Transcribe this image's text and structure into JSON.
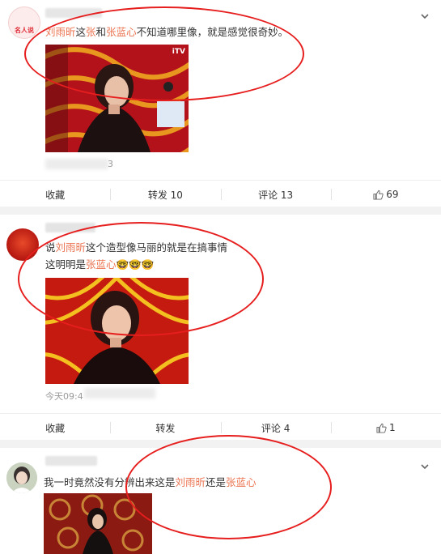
{
  "posts": [
    {
      "text_parts": [
        "刘雨昕",
        "这",
        "张",
        "和",
        "张蓝心",
        "不知道哪里像，就是感觉很奇妙。"
      ],
      "avatar_text": "名人说",
      "meta_suffix": "3",
      "watermark": "iTV",
      "actions": {
        "fav": "收藏",
        "repost": "转发 10",
        "comment": "评论 13",
        "like": "69"
      }
    },
    {
      "line1": [
        "说",
        "刘雨昕",
        "这个造型像马丽的就是在搞事情"
      ],
      "line2": [
        "这明明是",
        "张蓝心",
        "🤓🤓🤓"
      ],
      "time": "今天09:4",
      "actions": {
        "fav": "收藏",
        "repost": "转发",
        "comment": "评论 4",
        "like": "1"
      }
    },
    {
      "text_parts": [
        "我一时竟然没有分辨出来这是",
        "刘雨昕",
        "还是",
        "张蓝心"
      ]
    }
  ],
  "colors": {
    "highlight": "#eb7350",
    "circle": "#e61e1e",
    "text": "#333333",
    "meta": "#999999"
  },
  "icons": [
    "chevron-down-icon",
    "thumbs-up-icon"
  ]
}
